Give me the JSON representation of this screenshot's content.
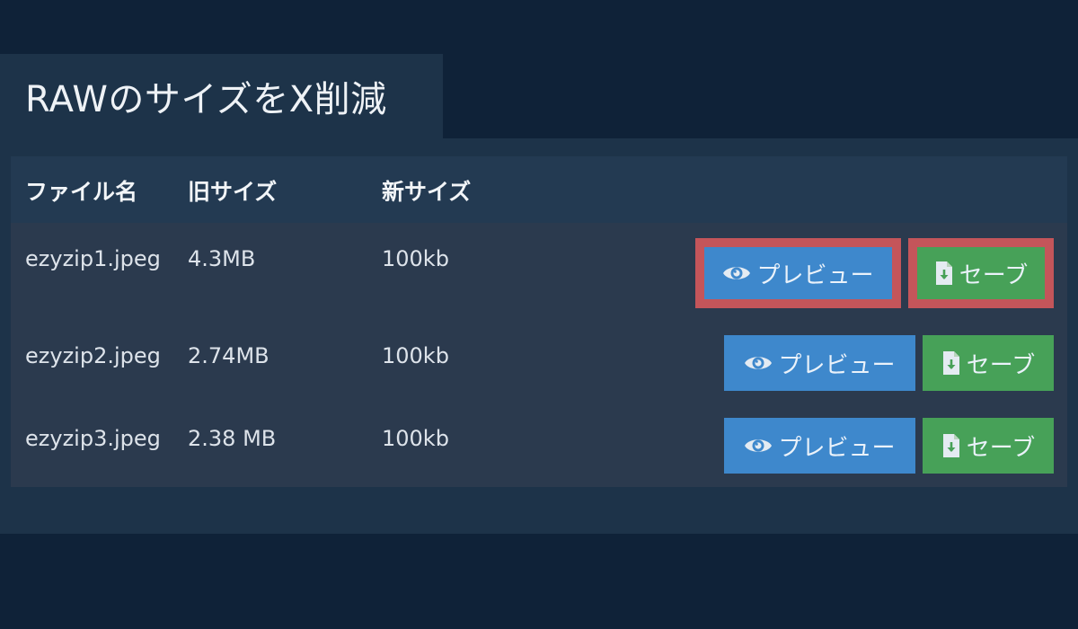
{
  "title": "RAWのサイズをX削減",
  "table": {
    "headers": {
      "filename": "ファイル名",
      "old_size": "旧サイズ",
      "new_size": "新サイズ"
    },
    "rows": [
      {
        "filename": "ezyzip1.jpeg",
        "old_size": "4.3MB",
        "new_size": "100kb",
        "preview_label": "プレビュー",
        "save_label": "セーブ",
        "highlighted": true
      },
      {
        "filename": "ezyzip2.jpeg",
        "old_size": "2.74MB",
        "new_size": "100kb",
        "preview_label": "プレビュー",
        "save_label": "セーブ",
        "highlighted": false
      },
      {
        "filename": "ezyzip3.jpeg",
        "old_size": "2.38 MB",
        "new_size": "100kb",
        "preview_label": "プレビュー",
        "save_label": "セーブ",
        "highlighted": false
      }
    ]
  },
  "icons": {
    "preview": "eye-icon",
    "save": "file-download-icon"
  },
  "colors": {
    "background": "#0f2238",
    "panel": "#1d3349",
    "row": "#2b3a4e",
    "preview_button": "#3e88cc",
    "save_button": "#47a158",
    "highlight_border": "#c4555a"
  }
}
